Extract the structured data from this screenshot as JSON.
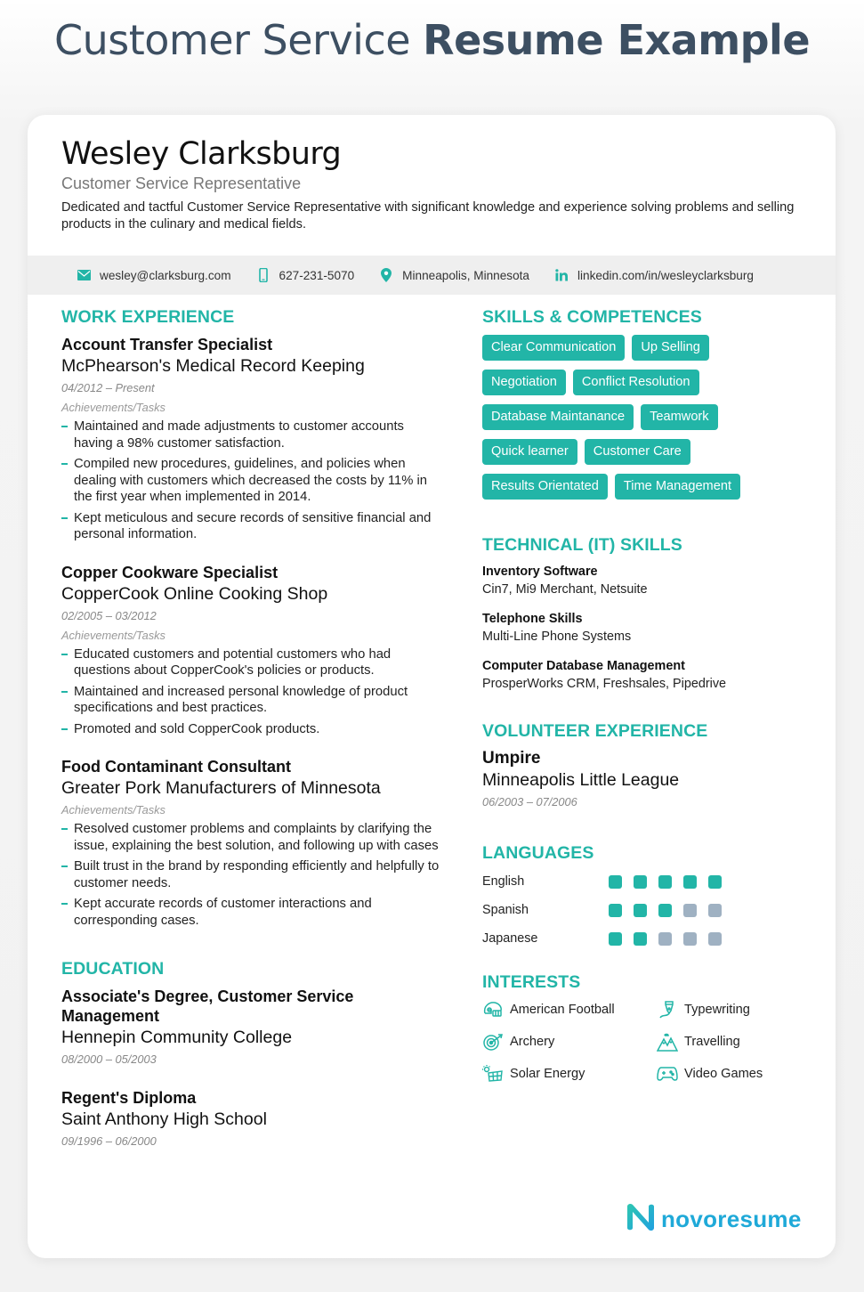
{
  "page_heading": {
    "light": "Customer Service ",
    "bold": "Resume Example"
  },
  "colors": {
    "accent": "#22b5a7",
    "dot_off": "#9fb1c2",
    "heading": "#3d4f62",
    "logo": "#1fa9d8"
  },
  "header": {
    "name": "Wesley Clarksburg",
    "role": "Customer Service Representative",
    "summary": "Dedicated and tactful Customer Service Representative with significant knowledge and experience solving problems and selling products in the culinary and medical fields."
  },
  "contact": [
    {
      "icon": "email-icon",
      "text": "wesley@clarksburg.com"
    },
    {
      "icon": "phone-icon",
      "text": "627-231-5070"
    },
    {
      "icon": "location-pin-icon",
      "text": "Minneapolis, Minnesota"
    },
    {
      "icon": "linkedin-icon",
      "text": "linkedin.com/in/wesleyclarksburg"
    }
  ],
  "work": {
    "title": "WORK EXPERIENCE",
    "jobs": [
      {
        "title": "Account Transfer Specialist",
        "company": "McPhearson's Medical Record Keeping",
        "dates": "04/2012 – Present",
        "label": "Achievements/Tasks",
        "bullets": [
          "Maintained and made adjustments to customer accounts having a 98% customer satisfaction.",
          "Compiled new procedures, guidelines, and policies when dealing with customers which decreased the costs by 11% in the first year when implemented in 2014.",
          "Kept meticulous and secure records of sensitive financial and personal information."
        ]
      },
      {
        "title": "Copper Cookware Specialist",
        "company": "CopperCook Online Cooking Shop",
        "dates": "02/2005 – 03/2012",
        "label": "Achievements/Tasks",
        "bullets": [
          "Educated customers and potential customers who had questions about CopperCook's policies or products.",
          "Maintained and increased personal knowledge of product specifications and best practices.",
          "Promoted and sold CopperCook products."
        ]
      },
      {
        "title": "Food Contaminant Consultant",
        "company": "Greater Pork Manufacturers of Minnesota",
        "dates": "",
        "label": "Achievements/Tasks",
        "bullets": [
          "Resolved customer problems and complaints by clarifying the issue, explaining the best solution, and following up with cases",
          "Built trust in the brand by responding efficiently and helpfully to customer needs.",
          "Kept accurate records of customer interactions and corresponding cases."
        ]
      }
    ]
  },
  "education": {
    "title": "EDUCATION",
    "items": [
      {
        "degree": "Associate's Degree, Customer Service Management",
        "school": "Hennepin Community College",
        "dates": "08/2000 – 05/2003"
      },
      {
        "degree": "Regent's Diploma",
        "school": "Saint Anthony High School",
        "dates": "09/1996 – 06/2000"
      }
    ]
  },
  "skills": {
    "title": "SKILLS & COMPETENCES",
    "tags": [
      "Clear Communication",
      "Up Selling",
      "Negotiation",
      "Conflict Resolution",
      "Database Maintanance",
      "Teamwork",
      "Quick learner",
      "Customer Care",
      "Results Orientated",
      "Time Management"
    ]
  },
  "technical": {
    "title": "TECHNICAL (IT) SKILLS",
    "items": [
      {
        "name": "Inventory Software",
        "value": "Cin7, Mi9 Merchant, Netsuite"
      },
      {
        "name": "Telephone Skills",
        "value": "Multi-Line Phone Systems"
      },
      {
        "name": "Computer Database Management",
        "value": "ProsperWorks CRM, Freshsales, Pipedrive"
      }
    ]
  },
  "volunteer": {
    "title": "VOLUNTEER EXPERIENCE",
    "role": "Umpire",
    "org": "Minneapolis Little League",
    "dates": "06/2003 – 07/2006"
  },
  "languages": {
    "title": "LANGUAGES",
    "max_level": 5,
    "items": [
      {
        "name": "English",
        "level": 5
      },
      {
        "name": "Spanish",
        "level": 3
      },
      {
        "name": "Japanese",
        "level": 2
      }
    ]
  },
  "interests": {
    "title": "INTERESTS",
    "items": [
      {
        "icon": "football-helmet-icon",
        "label": "American Football"
      },
      {
        "icon": "pen-nib-icon",
        "label": "Typewriting"
      },
      {
        "icon": "target-icon",
        "label": "Archery"
      },
      {
        "icon": "mountains-icon",
        "label": "Travelling"
      },
      {
        "icon": "solar-panel-icon",
        "label": "Solar Energy"
      },
      {
        "icon": "gamepad-icon",
        "label": "Video Games"
      }
    ]
  },
  "brand": {
    "name": "novoresume"
  }
}
